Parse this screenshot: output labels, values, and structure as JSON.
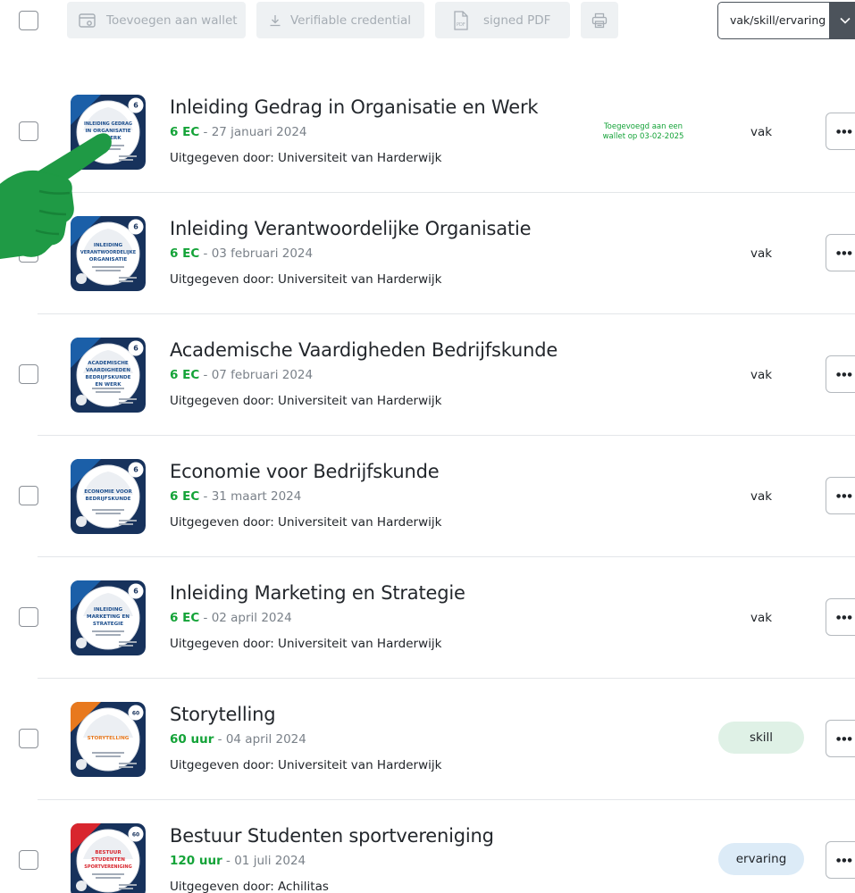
{
  "toolbar": {
    "wallet_label": "Toevoegen aan wallet",
    "vc_label": "Verifiable credential",
    "pdf_label": "signed PDF",
    "filter_value": "vak/skill/ervaring"
  },
  "items": [
    {
      "badge_lines": [
        "INLEIDING GEDRAG",
        "IN ORGANISATIE",
        "EN WERK"
      ],
      "badge_count": "6",
      "title": "Inleiding Gedrag in Organisatie en Werk",
      "amount": "6 EC",
      "date": " - 27 januari 2024",
      "issuer": "Uitgegeven door: Universiteit van Harderwijk",
      "wallet_note": "Toegevoegd aan een wallet op 03-02-2025",
      "type": "vak",
      "style": "plain",
      "color": "#1b5fa8"
    },
    {
      "badge_lines": [
        "INLEIDING",
        "VERANTWOORDELIJKE",
        "ORGANISATIE"
      ],
      "badge_count": "6",
      "title": "Inleiding Verantwoordelijke Organisatie",
      "amount": "6 EC",
      "date": " - 03 februari 2024",
      "issuer": "Uitgegeven door: Universiteit van Harderwijk",
      "wallet_note": "",
      "type": "vak",
      "style": "plain",
      "color": "#1b5fa8"
    },
    {
      "badge_lines": [
        "ACADEMISCHE",
        "VAARDIGHEDEN",
        "BEDRIJFSKUNDE",
        "EN WERK"
      ],
      "badge_count": "6",
      "title": "Academische Vaardigheden Bedrijfskunde",
      "amount": "6 EC",
      "date": " - 07 februari 2024",
      "issuer": "Uitgegeven door: Universiteit van Harderwijk",
      "wallet_note": "",
      "type": "vak",
      "style": "plain",
      "color": "#1b5fa8"
    },
    {
      "badge_lines": [
        "ECONOMIE VOOR",
        "BEDRIJFSKUNDE"
      ],
      "badge_count": "6",
      "title": "Economie voor Bedrijfskunde",
      "amount": "6 EC",
      "date": " - 31 maart 2024",
      "issuer": "Uitgegeven door: Universiteit van Harderwijk",
      "wallet_note": "",
      "type": "vak",
      "style": "plain",
      "color": "#1b5fa8"
    },
    {
      "badge_lines": [
        "INLEIDING",
        "MARKETING EN",
        "STRATEGIE"
      ],
      "badge_count": "6",
      "title": "Inleiding Marketing en Strategie",
      "amount": "6 EC",
      "date": " - 02 april 2024",
      "issuer": "Uitgegeven door: Universiteit van Harderwijk",
      "wallet_note": "",
      "type": "vak",
      "style": "plain",
      "color": "#1b5fa8"
    },
    {
      "badge_lines": [
        "STORYTELLING"
      ],
      "badge_count": "60",
      "title": "Storytelling",
      "amount": "60 uur",
      "date": " - 04 april 2024",
      "issuer": "Uitgegeven door: Universiteit van Harderwijk",
      "wallet_note": "",
      "type": "skill",
      "style": "pill-skill",
      "color": "#e8791e"
    },
    {
      "badge_lines": [
        "BESTUUR",
        "STUDENTEN",
        "SPORTVERENIGING"
      ],
      "badge_count": "60",
      "title": "Bestuur Studenten sportvereniging",
      "amount": "120 uur",
      "date": " - 01 juli 2024",
      "issuer": "Uitgegeven door: Achilitas",
      "wallet_note": "",
      "type": "ervaring",
      "style": "pill-ervaring",
      "color": "#d8262e"
    }
  ]
}
